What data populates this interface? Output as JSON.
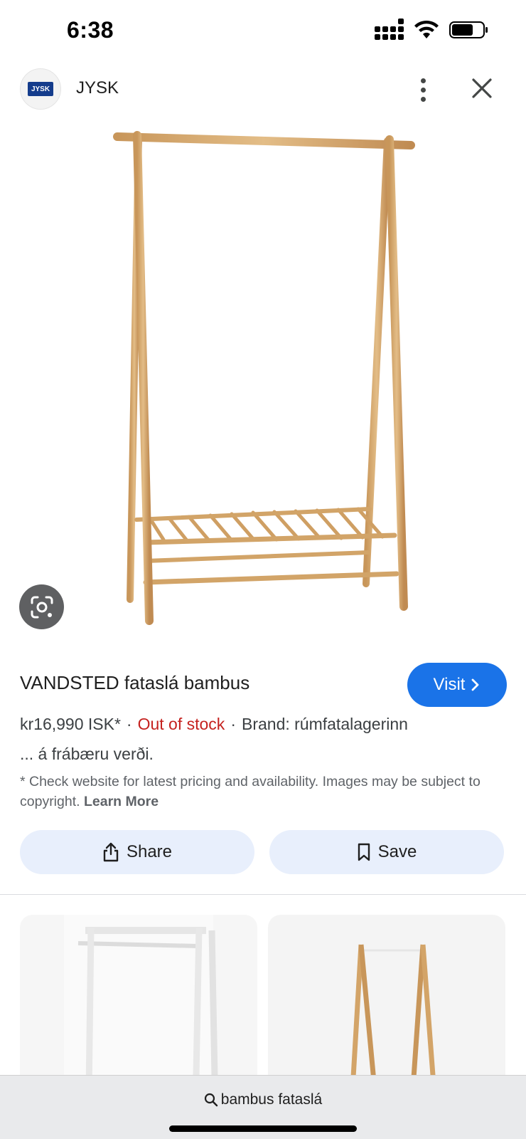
{
  "status_bar": {
    "time": "6:38",
    "battery_level": 0.6
  },
  "header": {
    "site_name": "JYSK",
    "logo_text": "JYSK"
  },
  "product": {
    "title": "VANDSTED fataslá bambus",
    "visit_label": "Visit",
    "price": "kr16,990 ISK*",
    "stock": "Out of stock",
    "brand": "Brand: rúmfatalagerinn",
    "snippet": "... á frábæru verði.",
    "disclaimer": "* Check website for latest pricing and availability. Images may be subject to copyright.",
    "learn_more": "Learn More"
  },
  "actions": {
    "share_label": "Share",
    "save_label": "Save"
  },
  "search": {
    "query": "bambus fataslá"
  },
  "colors": {
    "accent": "#1a73e8",
    "stock_red": "#c5221f",
    "bamboo": "#dcb27a"
  }
}
